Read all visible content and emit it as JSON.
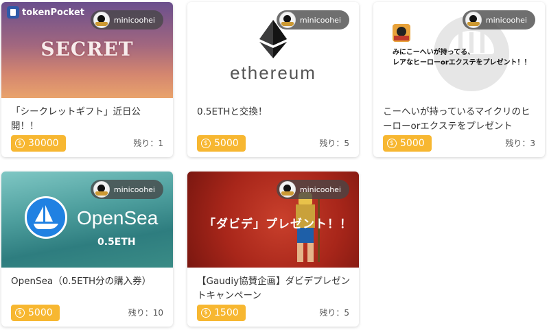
{
  "cards": [
    {
      "owner": "minicoohei",
      "thumb_brand": "tokenPocket",
      "thumb_text": "SECRET",
      "title": "「シークレットギフト」近日公開！！",
      "price": "30000",
      "remaining": "残り：1"
    },
    {
      "owner": "minicoohei",
      "thumb_text": "ethereum",
      "title": "0.5ETHと交換！",
      "price": "5000",
      "remaining": "残り：5"
    },
    {
      "owner": "minicoohei",
      "thumb_text_line1": "みにこーへいが持ってる、",
      "thumb_text_line2": "レアなヒーローorエクステをプレゼント！！",
      "title": "こーへいが持っているマイクリのヒーローorエクステをプレゼント",
      "price": "5000",
      "remaining": "残り：3"
    },
    {
      "owner": "minicoohei",
      "thumb_brand": "OpenSea",
      "thumb_sub": "0.5ETH",
      "title": "OpenSea（0.5ETH分の購入券）",
      "price": "5000",
      "remaining": "残り：10"
    },
    {
      "owner": "minicoohei",
      "thumb_text": "「ダビデ」プレゼント！！",
      "title": "【Gaudiy協賛企画】ダビデプレゼントキャンペーン",
      "price": "1500",
      "remaining": "残り：5"
    }
  ],
  "currency_symbol": "$"
}
